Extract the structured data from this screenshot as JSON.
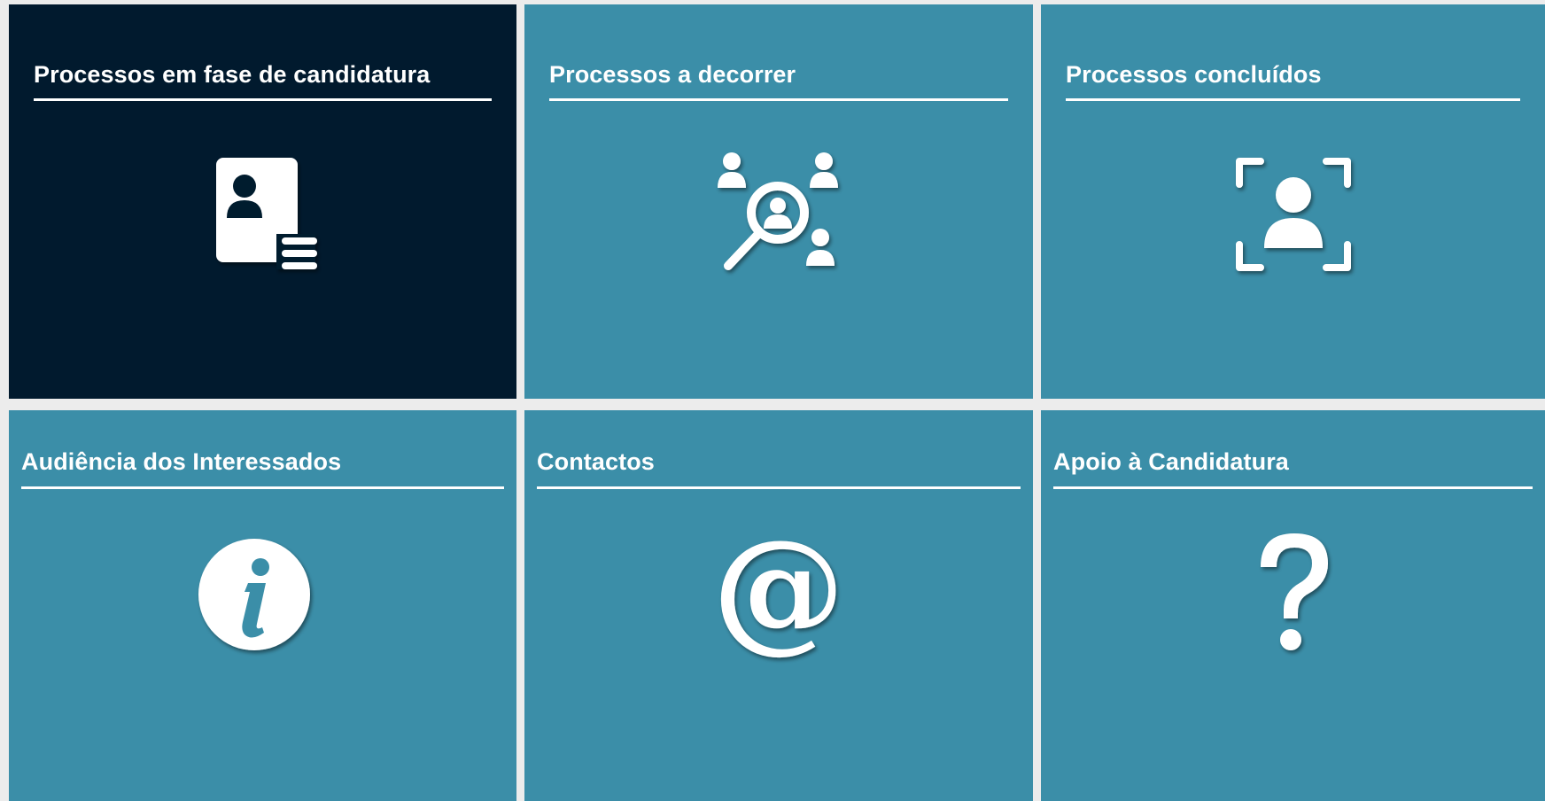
{
  "colors": {
    "page_background": "#ececec",
    "tile_teal": "#3b8ea8",
    "tile_active": "#011a2e",
    "foreground": "#ffffff"
  },
  "tiles": [
    {
      "title": "Processos em fase de candidatura",
      "icon": "id-card-list-icon",
      "active": true
    },
    {
      "title": "Processos a decorrer",
      "icon": "people-search-icon",
      "active": false
    },
    {
      "title": "Processos concluídos",
      "icon": "user-focus-frame-icon",
      "active": false
    },
    {
      "title": "Audiência dos Interessados",
      "icon": "info-icon",
      "active": false
    },
    {
      "title": "Contactos",
      "icon": "at-sign-icon",
      "active": false
    },
    {
      "title": "Apoio à Candidatura",
      "icon": "question-mark-icon",
      "active": false
    }
  ]
}
